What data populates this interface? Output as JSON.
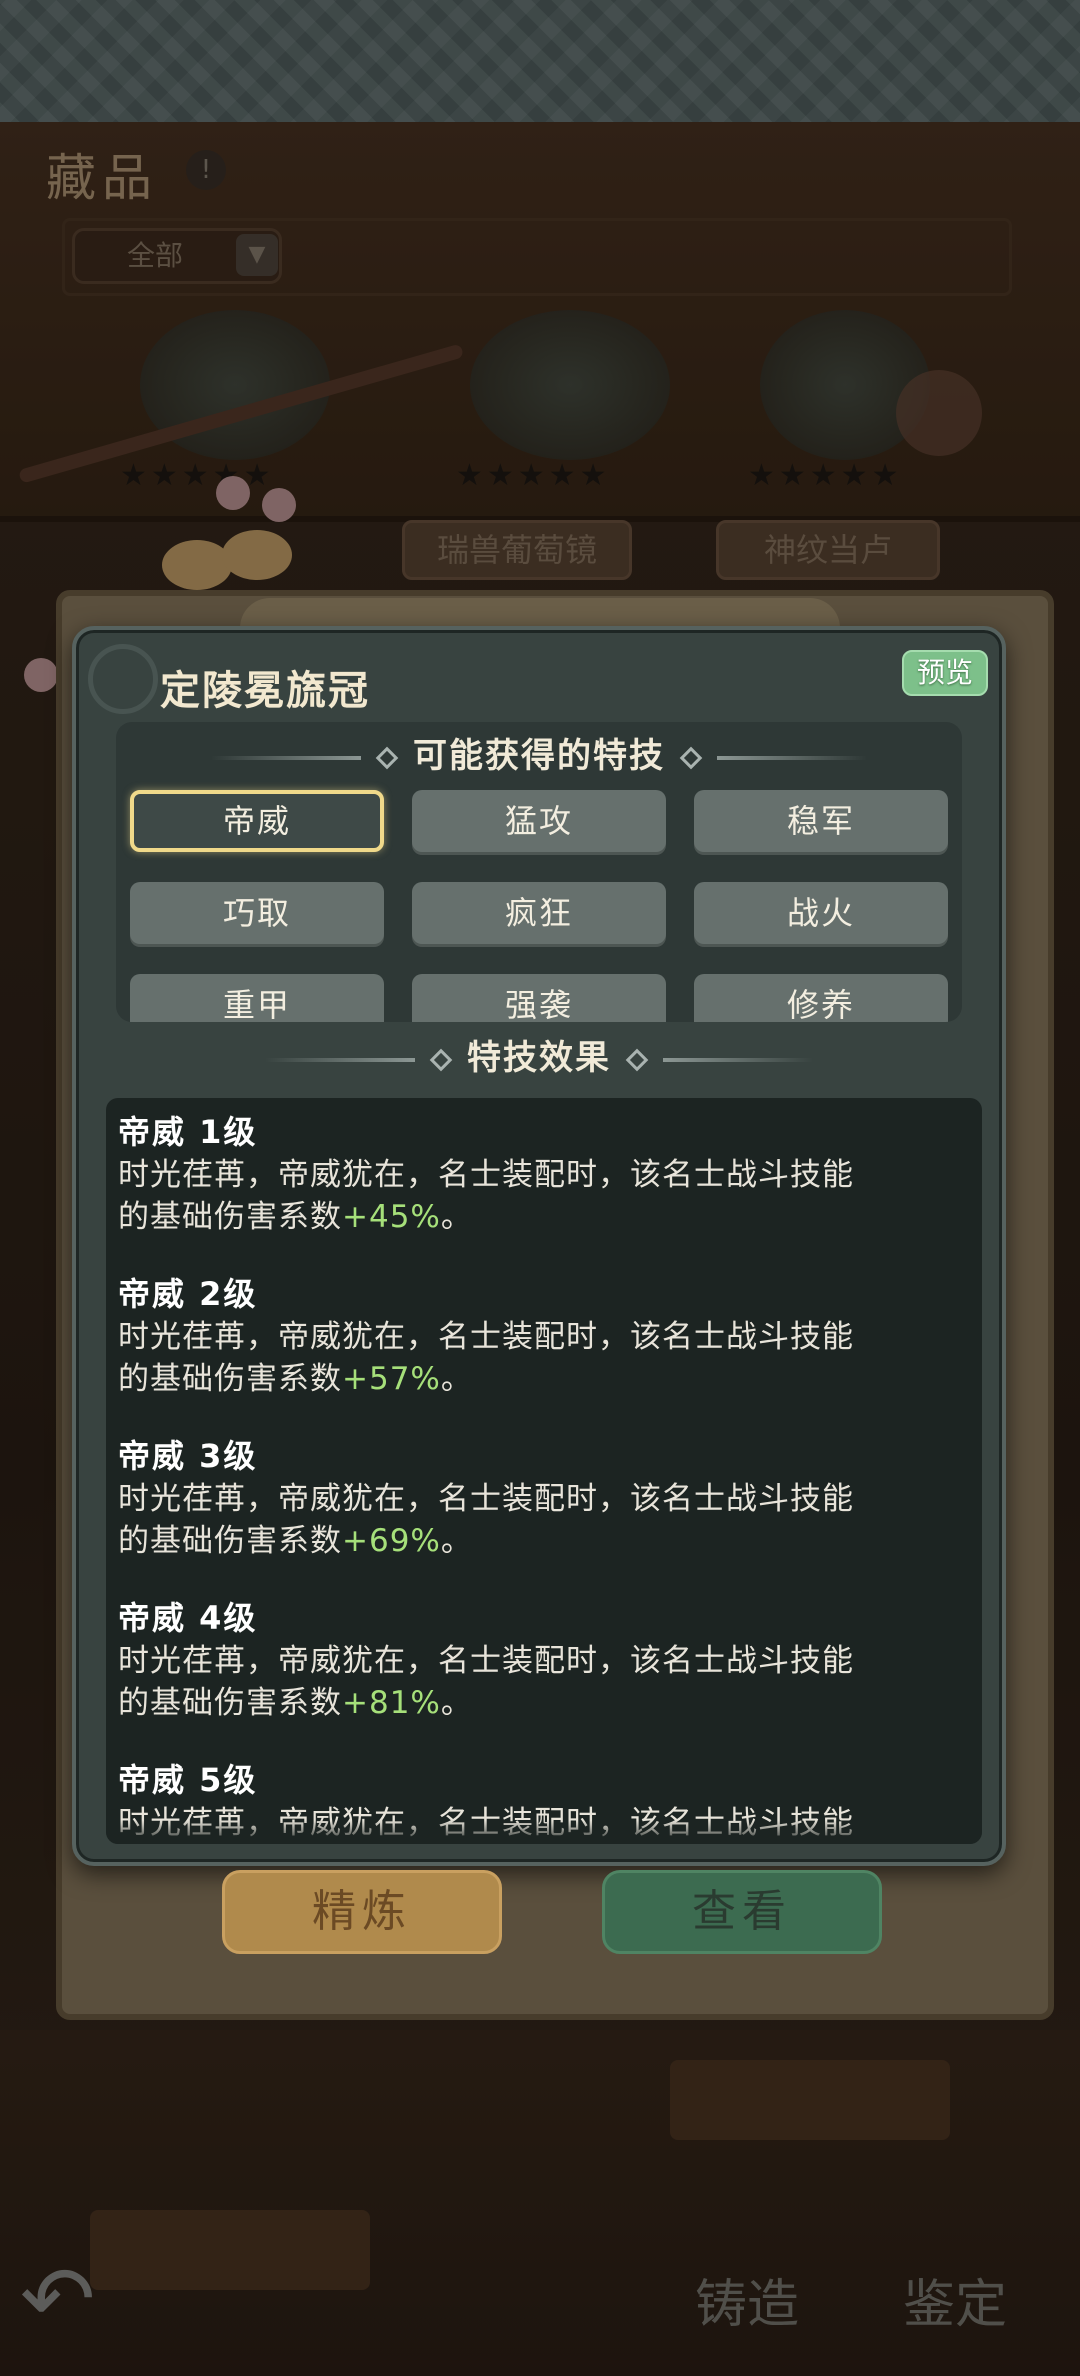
{
  "background": {
    "title": "藏品",
    "info_icon": "!",
    "filter_value": "全部",
    "plaques": [
      "瑞兽葡萄镜",
      "神纹当卢"
    ],
    "stars": "★★★★★",
    "back_icon": "back-arrow-icon",
    "bottom_buttons": [
      "铸造",
      "鉴定"
    ]
  },
  "modal": {
    "title": "定陵冕旒冠",
    "preview_label": "预览",
    "skills_header": "可能获得的特技",
    "skills": [
      "帝威",
      "猛攻",
      "稳军",
      "巧取",
      "疯狂",
      "战火",
      "重甲",
      "强袭",
      "修养"
    ],
    "selected_skill": "帝威",
    "effects_header": "特技效果",
    "effects": [
      {
        "title": "帝威 1级",
        "desc_line1": "时光荏苒，帝威犹在，名士装配时，该名士战斗技能",
        "desc_prefix": "的基础伤害系数",
        "value": "+45%",
        "desc_suffix": "。"
      },
      {
        "title": "帝威 2级",
        "desc_line1": "时光荏苒，帝威犹在，名士装配时，该名士战斗技能",
        "desc_prefix": "的基础伤害系数",
        "value": "+57%",
        "desc_suffix": "。"
      },
      {
        "title": "帝威 3级",
        "desc_line1": "时光荏苒，帝威犹在，名士装配时，该名士战斗技能",
        "desc_prefix": "的基础伤害系数",
        "value": "+69%",
        "desc_suffix": "。"
      },
      {
        "title": "帝威 4级",
        "desc_line1": "时光荏苒，帝威犹在，名士装配时，该名士战斗技能",
        "desc_prefix": "的基础伤害系数",
        "value": "+81%",
        "desc_suffix": "。"
      },
      {
        "title": "帝威 5级",
        "desc_line1": "时光荏苒，帝威犹在，名士装配时，该名士战斗技能"
      }
    ]
  },
  "actions": {
    "refine_label": "精炼",
    "view_label": "查看"
  },
  "colors": {
    "modal_bg": "#384340",
    "skill_selected_border": "#f0d98a",
    "value_green": "#a6e07a",
    "preview_green": "#7dc08a"
  }
}
